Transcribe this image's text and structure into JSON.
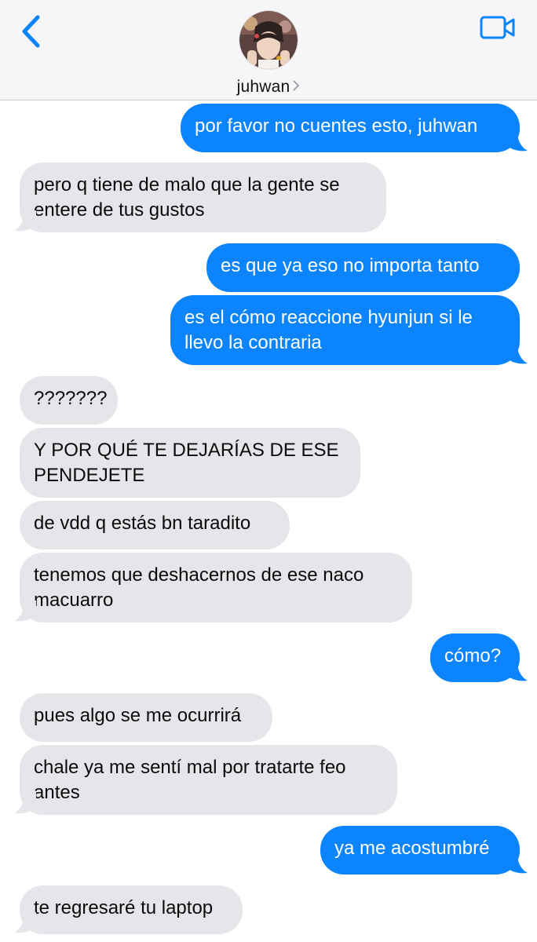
{
  "header": {
    "contact_name": "juhwan",
    "back_icon": "chevron-left-icon",
    "video_icon": "video-camera-icon",
    "accent_color": "#0b84fe"
  },
  "messages": [
    {
      "sender": "me",
      "text": "por favor no cuentes esto, juhwan"
    },
    {
      "sender": "them",
      "lines": [
        "pero q tiene de malo que la gente se",
        "entere de tus gustos"
      ]
    },
    {
      "sender": "me",
      "text": "es que ya eso no importa tanto"
    },
    {
      "sender": "me",
      "lines": [
        "es el cómo reaccione hyunjun si le",
        "llevo la contraria"
      ]
    },
    {
      "sender": "them",
      "text": "???????"
    },
    {
      "sender": "them",
      "lines": [
        "Y POR QUÉ TE DEJARÍAS DE ESE",
        "PENDEJETE"
      ]
    },
    {
      "sender": "them",
      "text": "de vdd q estás bn taradito"
    },
    {
      "sender": "them",
      "lines": [
        "tenemos que deshacernos de ese naco",
        "macuarro"
      ]
    },
    {
      "sender": "me",
      "text": "cómo?"
    },
    {
      "sender": "them",
      "text": "pues algo se me ocurrirá"
    },
    {
      "sender": "them",
      "lines": [
        "chale ya me sentí mal por tratarte feo",
        "antes"
      ]
    },
    {
      "sender": "me",
      "text": "ya me acostumbré"
    },
    {
      "sender": "them",
      "text": "te regresaré tu laptop"
    }
  ]
}
